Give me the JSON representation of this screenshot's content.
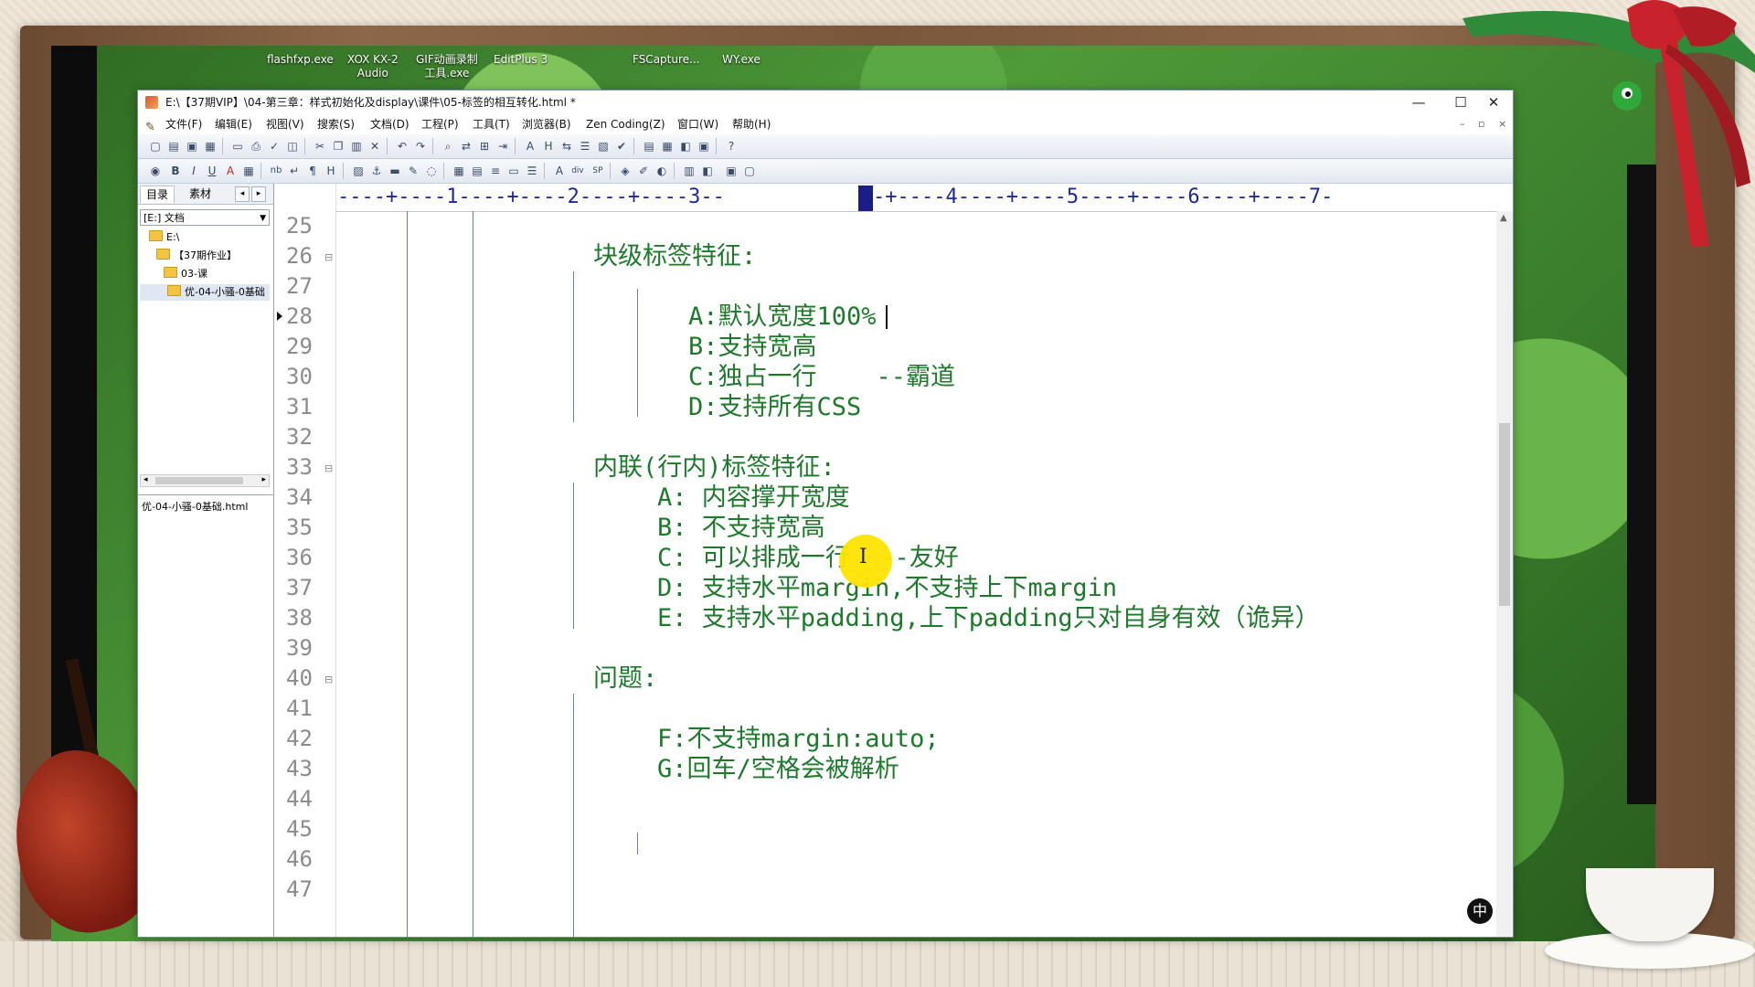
{
  "desktop": {
    "icons": [
      {
        "label": "flashfxp.exe"
      },
      {
        "label": "XOX KX-2\nAudio"
      },
      {
        "label": "GIF动画录制\n工具.exe"
      },
      {
        "label": "EditPlus 3"
      },
      {
        "label": "FSCapture..."
      },
      {
        "label": "WY.exe"
      }
    ]
  },
  "window": {
    "title": "E:\\【37期VIP】\\04-第三章：样式初始化及display\\课件\\05-标签的相互转化.html *",
    "controls": {
      "minimize": "—",
      "maximize": "☐",
      "close": "✕"
    }
  },
  "menu": {
    "items": [
      "文件(F)",
      "编辑(E)",
      "视图(V)",
      "搜索(S)",
      "文档(D)",
      "工程(P)",
      "工具(T)",
      "浏览器(B)",
      "Zen Coding(Z)",
      "窗口(W)",
      "帮助(H)"
    ],
    "mdi_controls": [
      "–",
      "▫",
      "×"
    ]
  },
  "toolbar2": {
    "labels": [
      "B",
      "I",
      "U",
      "A",
      "nb",
      "¶",
      "H",
      "A",
      "div",
      "SP"
    ]
  },
  "panel": {
    "tabs": [
      "目录",
      "素材"
    ],
    "drive": "[E:] 文档",
    "tree": [
      "E:\\",
      "【37期作业】",
      "03-课",
      "优-04-小骚-0基础"
    ],
    "file": "优-04-小骚-0基础.html"
  },
  "ruler": {
    "text": "----+----1----+----2----+----3--"
  },
  "ruler_tail": {
    "text": "-+----4----+----5----+----6----+----7-"
  },
  "editor": {
    "line_numbers": [
      "25",
      "26",
      "27",
      "28",
      "29",
      "30",
      "31",
      "32",
      "33",
      "34",
      "35",
      "36",
      "37",
      "38",
      "39",
      "40",
      "41",
      "42",
      "43",
      "44",
      "45",
      "46",
      "47"
    ],
    "lines": [
      {
        "n": "26",
        "text": "块级标签特征:"
      },
      {
        "n": "28",
        "text": "A:默认宽度100%"
      },
      {
        "n": "29",
        "text": "B:支持宽高"
      },
      {
        "n": "30",
        "text": "C:独占一行    --霸道"
      },
      {
        "n": "31",
        "text": "D:支持所有CSS"
      },
      {
        "n": "33",
        "text": "内联(行内)标签特征:"
      },
      {
        "n": "34",
        "text": "A: 内容撑开宽度"
      },
      {
        "n": "35",
        "text": "B: 不支持宽高"
      },
      {
        "n": "36",
        "text": "C: 可以排成一行  --友好"
      },
      {
        "n": "37",
        "text": "D: 支持水平margin,不支持上下margin"
      },
      {
        "n": "38",
        "text": "E: 支持水平padding,上下padding只对自身有效（诡异）"
      },
      {
        "n": "40",
        "text": "问题:"
      },
      {
        "n": "42",
        "text": "F:不支持margin:auto;"
      },
      {
        "n": "43",
        "text": "G:回车/空格会被解析"
      }
    ],
    "text_color": "#1d7a2a"
  },
  "ime": {
    "label": "中"
  }
}
